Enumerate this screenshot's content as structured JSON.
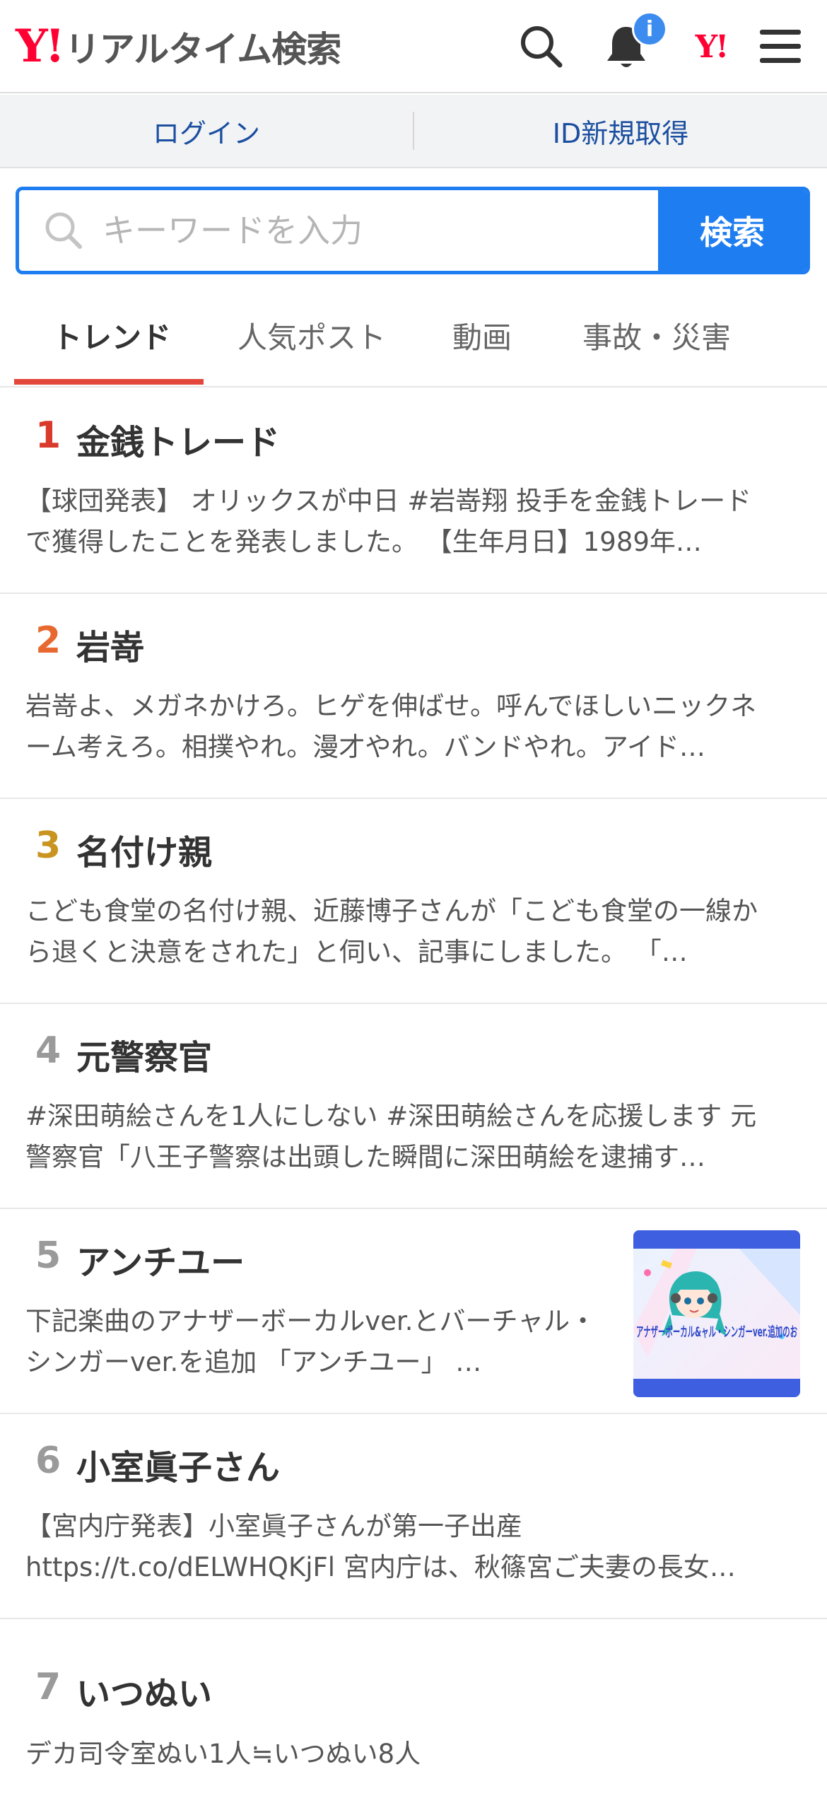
{
  "header": {
    "logo_mark": "Y!",
    "logo_text": "リアルタイム検索",
    "notification_badge": "i",
    "yj_mark": "Y!"
  },
  "loginbar": {
    "login": "ログイン",
    "register": "ID新規取得"
  },
  "search": {
    "placeholder": "キーワードを入力",
    "button": "検索"
  },
  "tabs": [
    "トレンド",
    "人気ポスト",
    "動画",
    "事故・災害"
  ],
  "trends": [
    {
      "rank": "1",
      "word": "金銭トレード",
      "desc": "【球団発表】 オリックスが中日 #岩嵜翔 投手を金銭トレードで獲得したことを発表しました。 【生年月日】1989年…",
      "rank_color": "#d93a2b"
    },
    {
      "rank": "2",
      "word": "岩嵜",
      "desc": "岩嵜よ、メガネかけろ。ヒゲを伸ばせ。呼んでほしいニックネーム考えろ。相撲やれ。漫才やれ。バンドやれ。アイド…",
      "rank_color": "#e8692f"
    },
    {
      "rank": "3",
      "word": "名付け親",
      "desc": "こども食堂の名付け親、近藤博子さんが「こども食堂の一線から退くと決意をされた」と伺い、記事にしました。 「…",
      "rank_color": "#c99520"
    },
    {
      "rank": "4",
      "word": "元警察官",
      "desc": "#深田萌絵さんを1人にしない #深田萌絵さんを応援します 元警察官「八王子警察は出頭した瞬間に深田萌絵を逮捕す…",
      "rank_color": "#9a9a9a"
    },
    {
      "rank": "5",
      "word": "アンチユー",
      "desc": "下記楽曲のアナザーボーカルver.とバーチャル・シンガーver.を追加 「アンチユー」 …",
      "rank_color": "#9a9a9a",
      "thumb_text": "アナザーボーカル&ャル・シンガーver.追加のお"
    },
    {
      "rank": "6",
      "word": "小室眞子さん",
      "desc": "【宮内庁発表】小室眞子さんが第一子出産 https://t.co/dELWHQKjFl 宮内庁は、秋篠宮ご夫妻の長女…",
      "rank_color": "#9a9a9a"
    },
    {
      "rank": "7",
      "word": "いつぬい",
      "desc": "デカ司令室ぬい1人≒いつぬい8人",
      "rank_color": "#9a9a9a"
    }
  ]
}
